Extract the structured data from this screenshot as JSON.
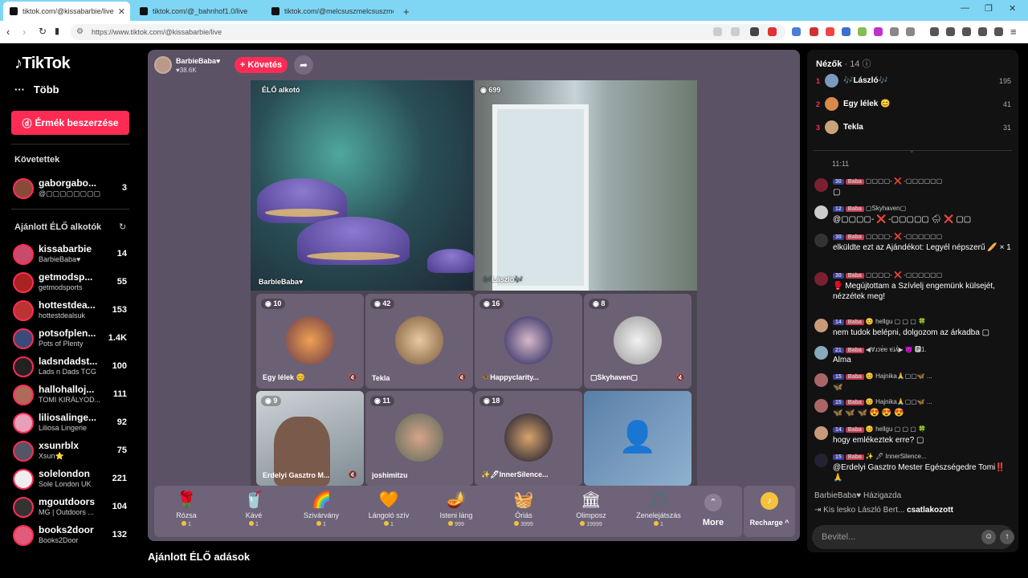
{
  "browser": {
    "tabs": [
      {
        "title": "tiktok.com/@kissabarbie/live"
      },
      {
        "title": "tiktok.com/@_bahnhof1.0/live"
      },
      {
        "title": "tiktok.com/@melcsuszmelcsuszmelc..."
      }
    ],
    "new_tab": "+",
    "url": "https://www.tiktok.com/@kissabarbie/live"
  },
  "sidebar": {
    "logo": "TikTok",
    "more": "Több",
    "coins_button": "Érmék beszerzése",
    "following_title": "Követettek",
    "following": [
      {
        "name": "gaborgabo...",
        "sub": "@▢▢▢▢▢▢▢▢",
        "count": "3"
      }
    ],
    "recommended_title": "Ajánlott ÉLŐ alkotók",
    "recommended": [
      {
        "name": "kissabarbie",
        "sub": "BarbieBaba♥",
        "count": "14"
      },
      {
        "name": "getmodsp...",
        "sub": "getmodsports",
        "count": "55"
      },
      {
        "name": "hottestdea...",
        "sub": "hottestdealsuk",
        "count": "153"
      },
      {
        "name": "potsofplen...",
        "sub": "Pots of Plenty",
        "count": "1.4K"
      },
      {
        "name": "ladsndadst...",
        "sub": "Lads n Dads TCG",
        "count": "100"
      },
      {
        "name": "hallohalloj...",
        "sub": "TOMI KIRÁLYOD...",
        "count": "111"
      },
      {
        "name": "liliosalinge...",
        "sub": "Liliosa Lingerie",
        "count": "92"
      },
      {
        "name": "xsunrblx",
        "sub": "Xsun⭐",
        "count": "75"
      },
      {
        "name": "solelondon",
        "sub": "Sole London UK",
        "count": "221"
      },
      {
        "name": "mgoutdoors",
        "sub": "MG | Outdoors ...",
        "count": "104"
      },
      {
        "name": "books2door",
        "sub": "Books2Door",
        "count": "132"
      }
    ]
  },
  "stream": {
    "host_name": "BarbieBaba♥",
    "host_likes": "♥38.6K",
    "follow_button": "+ Követés",
    "main_tag": "ÉLŐ alkotó",
    "main_name": "BarbieBaba♥",
    "guest_main": {
      "count": "699",
      "name": "🎶László🎶"
    },
    "tiles": [
      {
        "count": "10",
        "name": "Egy lélek 😊"
      },
      {
        "count": "42",
        "name": "Tekla"
      },
      {
        "count": "16",
        "name": "🦋Happyclarity..."
      },
      {
        "count": "8",
        "name": "▢Skyhaven▢"
      },
      {
        "count": "9",
        "name": "Erdelyi Gasztro M..."
      },
      {
        "count": "11",
        "name": "joshimitzu"
      },
      {
        "count": "18",
        "name": "✨🖊InnerSilence..."
      }
    ],
    "recommended_heading": "Ajánlott ÉLŐ adások"
  },
  "gifts": [
    {
      "icon": "🌹",
      "name": "Rózsa",
      "price": "1"
    },
    {
      "icon": "🥤",
      "name": "Kávé",
      "price": "1"
    },
    {
      "icon": "🌈",
      "name": "Szivárvány",
      "price": "1"
    },
    {
      "icon": "🧡",
      "name": "Lángoló szív",
      "price": "1"
    },
    {
      "icon": "🪔",
      "name": "Isteni láng",
      "price": "999"
    },
    {
      "icon": "🧺",
      "name": "Óriás",
      "price": "3999"
    },
    {
      "icon": "🏛",
      "name": "Olimposz",
      "price": "19999"
    },
    {
      "icon": "🎵",
      "name": "Zenelejátszás",
      "price": "1"
    }
  ],
  "gift_more": "More",
  "recharge": "Recharge ^",
  "chat": {
    "viewers_label": "Nézők",
    "viewers_count": "· 14",
    "top_viewers": [
      {
        "rank": "1",
        "name": "🎶László🎶",
        "score": "195"
      },
      {
        "rank": "2",
        "name": "Egy lélek 😊",
        "score": "41"
      },
      {
        "rank": "3",
        "name": "Tekla",
        "score": "31"
      }
    ],
    "time": "11:11",
    "messages": [
      {
        "level": "30",
        "fan": "Baba",
        "user": "▢▢▢▢- ❌ -▢▢▢▢▢▢",
        "text": "▢"
      },
      {
        "level": "12",
        "fan": "Baba",
        "user": "▢Skyhaven▢",
        "text": "@▢▢▢▢- ❌ -▢▢▢▢▢ 🌧 ❌ ▢▢"
      },
      {
        "level": "30",
        "fan": "Baba",
        "user": "▢▢▢▢- ❌ -▢▢▢▢▢▢",
        "text": "elküldte ezt az Ajándékot: Legyél népszerű 🥖 × 1"
      },
      {
        "level": "30",
        "fan": "Baba",
        "user": "▢▢▢▢- ❌ -▢▢▢▢▢▢",
        "text": "🥊 Megújtottam a Szívlelj engemünk külsejét, nézzétek meg!"
      },
      {
        "level": "14",
        "fan": "Baba",
        "user": "😊 hellgu ▢ ▢ ▢ 🍀",
        "text": "nem tudok belépni, dolgozom az árkadba ▢"
      },
      {
        "level": "21",
        "fan": "Baba",
        "user": "◀Ɐɹɔɐ́ɐ ɐɹ̈ʎ́▶ 😈 🅿1.",
        "text": "Alma"
      },
      {
        "level": "15",
        "fan": "Baba",
        "user": "😊 Hajnika🙏▢▢🦋 ...",
        "text": "🦋"
      },
      {
        "level": "15",
        "fan": "Baba",
        "user": "😊 Hajnika🙏▢▢🦋 ...",
        "text": "🦋 🦋 🦋 😍 😍 😍"
      },
      {
        "level": "14",
        "fan": "Baba",
        "user": "😊 hellgu ▢ ▢ ▢ 🍀",
        "text": "hogy emlékeztek erre? ▢"
      },
      {
        "level": "15",
        "fan": "Baba",
        "user": "✨ 🖊 InnerSilence...",
        "text": "@Erdelyi Gasztro Mester Egészségedre Tomi‼️🙏"
      }
    ],
    "host_message": "BarbieBaba♥  Házigazda",
    "joined_user": "Kis lesko László Bert...",
    "joined_text": " csatlakozott",
    "input_placeholder": "Bevitel..."
  }
}
